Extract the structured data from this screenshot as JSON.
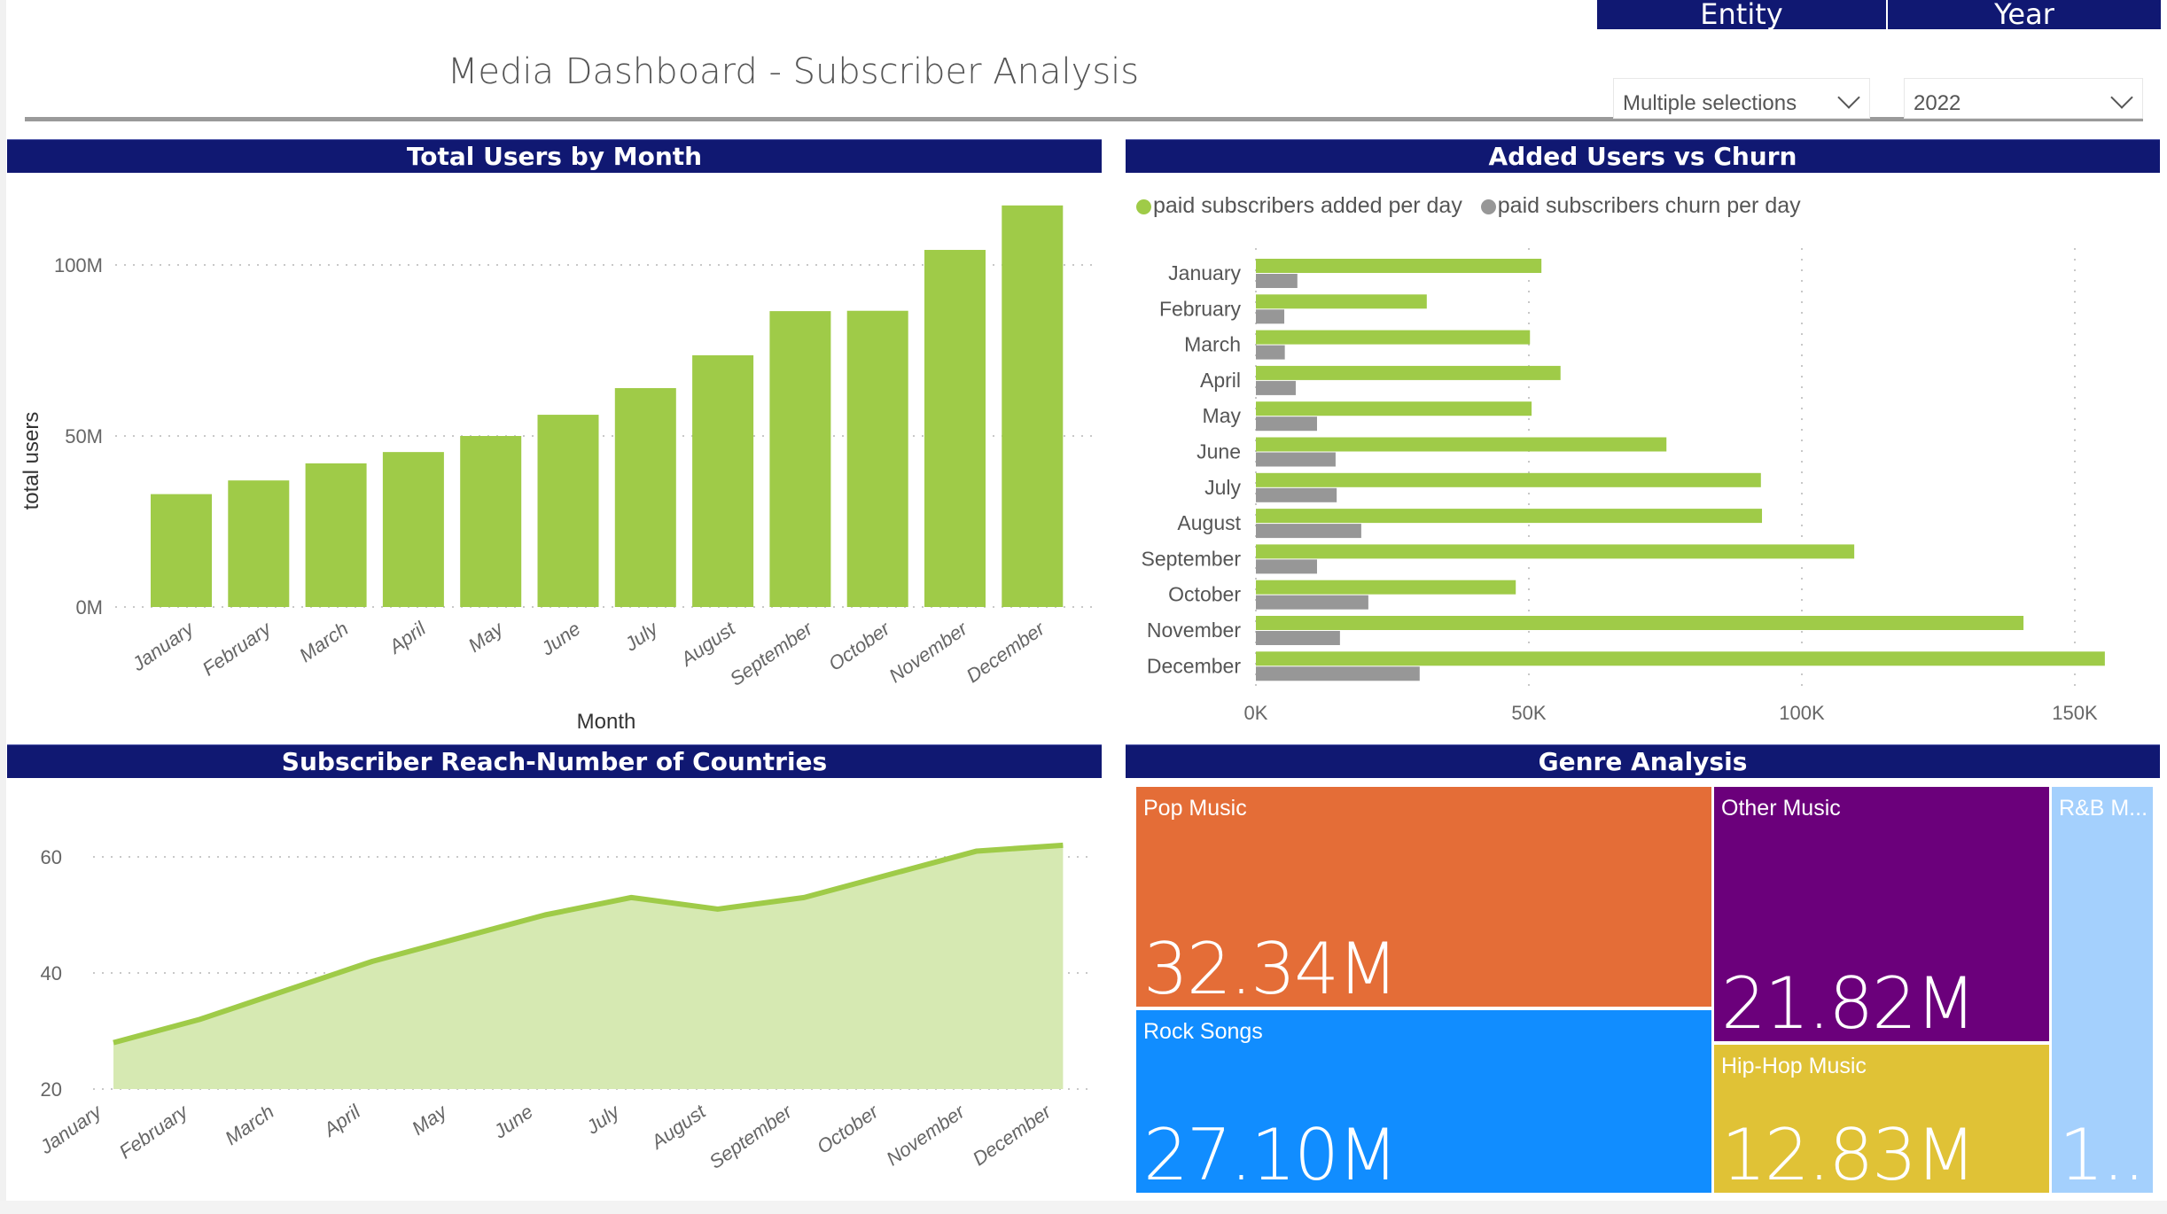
{
  "header": {
    "title": "Media Dashboard - Subscriber Analysis"
  },
  "slicers": {
    "entity": {
      "label": "Entity",
      "value": "Multiple selections"
    },
    "year": {
      "label": "Year",
      "value": "2022"
    }
  },
  "colors": {
    "header_bg": "#101872",
    "green": "#9fcb48",
    "green_fill": "#d6e9b2",
    "gray": "#979797",
    "pop": "#e46d37",
    "rock": "#118dff",
    "other": "#6b007b",
    "hiphop": "#e0c236",
    "rnb": "#a4d0fd"
  },
  "panels": {
    "total_users": {
      "title": "Total Users by Month"
    },
    "added_vs_churn": {
      "title": "Added Users vs Churn"
    },
    "reach": {
      "title": "Subscriber Reach-Number of Countries"
    },
    "genre": {
      "title": "Genre Analysis"
    }
  },
  "chart_data": [
    {
      "id": "total_users",
      "type": "bar",
      "title": "Total Users by Month",
      "xlabel": "Month",
      "ylabel": "total users",
      "categories": [
        "January",
        "February",
        "March",
        "April",
        "May",
        "June",
        "July",
        "August",
        "September",
        "October",
        "November",
        "December"
      ],
      "values": [
        33000000,
        37000000,
        42000000,
        45300000,
        50000000,
        56200000,
        64000000,
        73600000,
        86500000,
        86600000,
        104400000,
        117400000
      ],
      "ylim": [
        0,
        120000000
      ],
      "yticks": [
        0,
        50000000,
        100000000
      ],
      "ytick_labels": [
        "0M",
        "50M",
        "100M"
      ],
      "grid": true
    },
    {
      "id": "added_vs_churn",
      "type": "bar",
      "orientation": "horizontal",
      "title": "Added Users vs Churn",
      "categories": [
        "January",
        "February",
        "March",
        "April",
        "May",
        "June",
        "July",
        "August",
        "September",
        "October",
        "November",
        "December"
      ],
      "series": [
        {
          "name": "paid subscribers added per day",
          "color": "#9fcb48",
          "values": [
            52300,
            31300,
            50200,
            55800,
            50500,
            75200,
            92500,
            92700,
            109600,
            47600,
            140600,
            155500
          ]
        },
        {
          "name": "paid subscribers churn per day",
          "color": "#979797",
          "values": [
            7600,
            5200,
            5300,
            7300,
            11200,
            14600,
            14800,
            19300,
            11200,
            20600,
            15400,
            30000
          ]
        }
      ],
      "xlim": [
        0,
        160000
      ],
      "xticks": [
        0,
        50000,
        100000,
        150000
      ],
      "xtick_labels": [
        "0K",
        "50K",
        "100K",
        "150K"
      ],
      "legend": "top-left",
      "grid": true
    },
    {
      "id": "reach",
      "type": "area",
      "title": "Subscriber Reach-Number of Countries",
      "categories": [
        "January",
        "February",
        "March",
        "April",
        "May",
        "June",
        "July",
        "August",
        "September",
        "October",
        "November",
        "December"
      ],
      "values": [
        28,
        32,
        37,
        42,
        46,
        50,
        53,
        51,
        53,
        57,
        61,
        62
      ],
      "ylim": [
        20,
        65
      ],
      "yticks": [
        20,
        40,
        60
      ],
      "ytick_labels": [
        "20",
        "40",
        "60"
      ],
      "grid": true
    },
    {
      "id": "genre",
      "type": "treemap",
      "title": "Genre Analysis",
      "items": [
        {
          "name": "Pop Music",
          "value_label": "32.34M",
          "value": 32340000
        },
        {
          "name": "Rock Songs",
          "value_label": "27.10M",
          "value": 27100000
        },
        {
          "name": "Other Music",
          "value_label": "21.82M",
          "value": 21820000
        },
        {
          "name": "Hip-Hop Music",
          "value_label": "12.83M",
          "value": 12830000
        },
        {
          "name": "R&B M...",
          "value_label": "1...",
          "value": null
        }
      ]
    }
  ]
}
